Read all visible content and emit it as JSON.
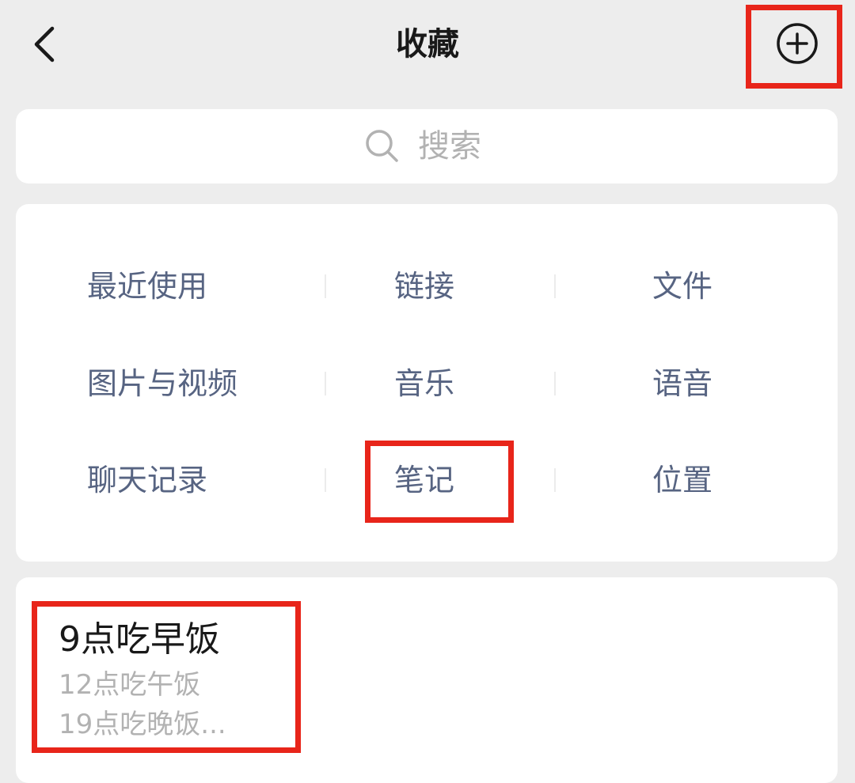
{
  "header": {
    "title": "收藏",
    "back_icon": "chevron-left-icon",
    "add_icon": "plus-circle-icon"
  },
  "search": {
    "placeholder": "搜索",
    "icon": "search-icon"
  },
  "categories": {
    "row1": [
      "最近使用",
      "链接",
      "文件"
    ],
    "row2": [
      "图片与视频",
      "音乐",
      "语音"
    ],
    "row3": [
      "聊天记录",
      "笔记",
      "位置"
    ]
  },
  "note": {
    "title": "9点吃早饭",
    "line1": "12点吃午饭",
    "line2": "19点吃晚饭..."
  },
  "colors": {
    "background": "#ededed",
    "card": "#ffffff",
    "category_text": "#576482",
    "highlight": "#e8251a",
    "muted": "#b2b2b2"
  }
}
